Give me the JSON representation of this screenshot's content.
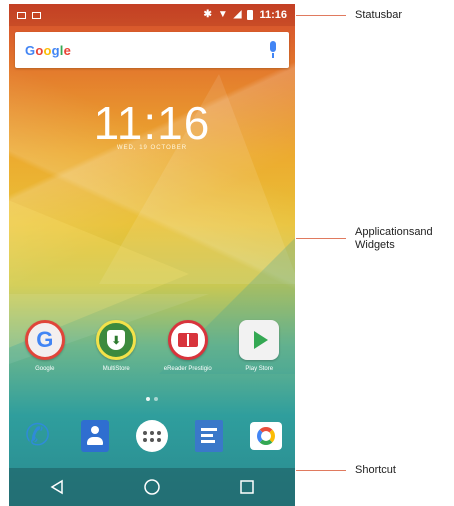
{
  "statusbar": {
    "time": "11:16",
    "icons": [
      "notification-icon",
      "notification-icon",
      "bluetooth-icon",
      "wifi-icon",
      "signal-icon",
      "battery-icon"
    ]
  },
  "search": {
    "logo": "Google",
    "mic_icon": "mic-icon"
  },
  "clock": {
    "time": "11:16",
    "date": "WED, 19 OCTOBER"
  },
  "apps": [
    {
      "label": "Google",
      "icon": "google-icon"
    },
    {
      "label": "MultiStore",
      "icon": "multistore-icon"
    },
    {
      "label": "eReader Prestigio",
      "icon": "ereader-icon"
    },
    {
      "label": "Play Store",
      "icon": "play-store-icon"
    }
  ],
  "dock": [
    {
      "icon": "phone-icon"
    },
    {
      "icon": "contacts-icon"
    },
    {
      "icon": "app-drawer-icon"
    },
    {
      "icon": "messages-icon"
    },
    {
      "icon": "camera-icon"
    }
  ],
  "navbar": {
    "icons": [
      "back-icon",
      "home-icon",
      "recents-icon"
    ]
  },
  "callouts": {
    "statusbar": "Statusbar",
    "applications_line1": "Applicationsand",
    "applications_line2": "Widgets",
    "shortcut": "Shortcut"
  },
  "colors": {
    "callout_line": "#e07a5f",
    "google_blue": "#4285F4"
  }
}
